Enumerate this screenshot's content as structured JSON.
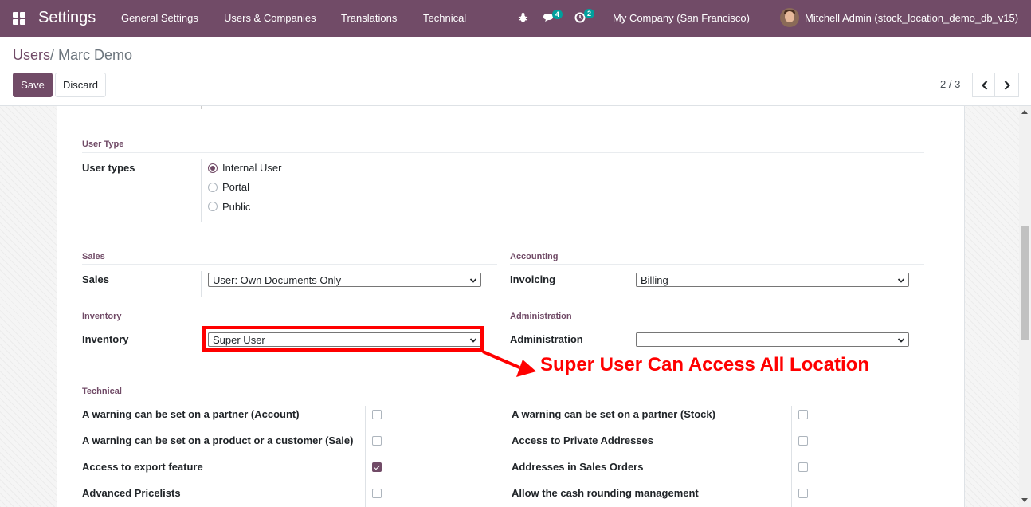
{
  "topbar": {
    "brand": "Settings",
    "menu": [
      "General Settings",
      "Users & Companies",
      "Translations",
      "Technical"
    ],
    "chat_badge": "4",
    "activity_badge": "2",
    "company": "My Company (San Francisco)",
    "user": "Mitchell Admin (stock_location_demo_db_v15)"
  },
  "control_panel": {
    "breadcrumb_parent": "Users",
    "breadcrumb_sep": "/",
    "breadcrumb_current": "Marc Demo",
    "save_label": "Save",
    "discard_label": "Discard",
    "pager": "2 / 3"
  },
  "form": {
    "user_type_section": "User Type",
    "user_types_label": "User types",
    "user_types": [
      {
        "label": "Internal User",
        "selected": true
      },
      {
        "label": "Portal",
        "selected": false
      },
      {
        "label": "Public",
        "selected": false
      }
    ],
    "sales_section": "Sales",
    "sales_label": "Sales",
    "sales_value": "User: Own Documents Only",
    "accounting_section": "Accounting",
    "invoicing_label": "Invoicing",
    "invoicing_value": "Billing",
    "inventory_section": "Inventory",
    "inventory_label": "Inventory",
    "inventory_value": "Super User",
    "administration_section": "Administration",
    "administration_label": "Administration",
    "administration_value": "",
    "technical_section": "Technical",
    "technical_left": [
      {
        "label": "A warning can be set on a partner (Account)",
        "checked": false
      },
      {
        "label": "A warning can be set on a product or a customer (Sale)",
        "checked": false
      },
      {
        "label": "Access to export feature",
        "checked": true
      },
      {
        "label": "Advanced Pricelists",
        "checked": false
      }
    ],
    "technical_right": [
      {
        "label": "A warning can be set on a partner (Stock)",
        "checked": false
      },
      {
        "label": "Access to Private Addresses",
        "checked": false
      },
      {
        "label": "Addresses in Sales Orders",
        "checked": false
      },
      {
        "label": "Allow the cash rounding management",
        "checked": false
      }
    ]
  },
  "annotation": "Super User Can Access All Location",
  "colors": {
    "brand": "#714b67",
    "annotation": "#ff0000"
  }
}
